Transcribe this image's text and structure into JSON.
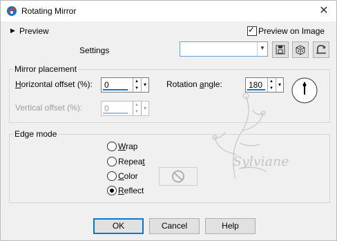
{
  "window": {
    "title": "Rotating Mirror"
  },
  "preview": {
    "label": "Preview"
  },
  "preview_on_image": {
    "label": "Preview on Image",
    "checked": true
  },
  "settings": {
    "label": "Settings",
    "value": ""
  },
  "mirror_placement": {
    "title": "Mirror placement",
    "horizontal_offset": {
      "label_pre": "",
      "label_hot": "H",
      "label_post": "orizontal offset (%):",
      "value": "0"
    },
    "vertical_offset": {
      "label": "Vertical offset (%):",
      "value": "0"
    },
    "rotation_angle": {
      "label_pre": "Rotation ",
      "label_hot": "a",
      "label_post": "ngle:",
      "value": "180"
    }
  },
  "edge_mode": {
    "title": "Edge mode",
    "options": [
      {
        "hot": "W",
        "rest": "rap",
        "checked": false
      },
      {
        "pre": "Repea",
        "hot": "t",
        "rest": "",
        "checked": false
      },
      {
        "pre": "",
        "hot": "C",
        "rest": "olor",
        "checked": false
      },
      {
        "pre": "",
        "hot": "R",
        "rest": "eflect",
        "checked": true
      }
    ]
  },
  "watermark": {
    "text": "Sylviane"
  },
  "buttons": {
    "ok": "OK",
    "cancel": "Cancel",
    "help": "Help"
  }
}
